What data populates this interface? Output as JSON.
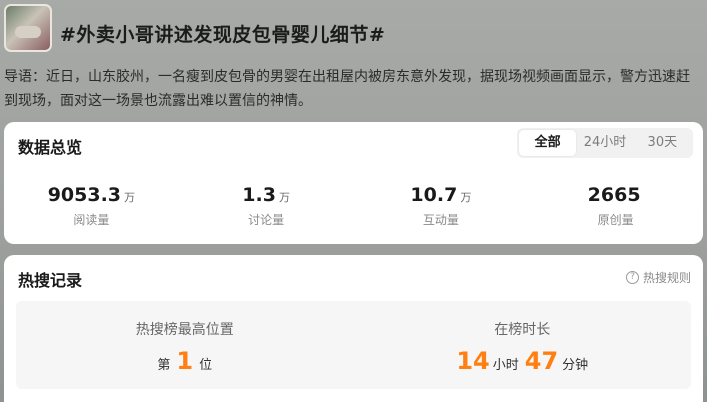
{
  "topic": {
    "title": "#外卖小哥讲述发现皮包骨婴儿细节#",
    "guide": "导语：近日，山东胶州，一名瘦到皮包骨的男婴在出租屋内被房东意外发现，据现场视频画面显示，警方迅速赶到现场，面对这一场景也流露出难以置信的神情。"
  },
  "overview": {
    "title": "数据总览",
    "tabs": [
      "全部",
      "24小时",
      "30天"
    ],
    "active_tab": "全部",
    "stats": [
      {
        "value": "9053.3",
        "unit": "万",
        "label": "阅读量"
      },
      {
        "value": "1.3",
        "unit": "万",
        "label": "讨论量"
      },
      {
        "value": "10.7",
        "unit": "万",
        "label": "互动量"
      },
      {
        "value": "2665",
        "unit": "",
        "label": "原创量"
      }
    ]
  },
  "hot": {
    "title": "热搜记录",
    "rules_label": "热搜规则",
    "rules_icon": "question-circle-icon",
    "peak": {
      "label": "热搜榜最高位置",
      "prefix": "第",
      "value": "1",
      "suffix": "位"
    },
    "duration": {
      "label": "在榜时长",
      "hours": "14",
      "hours_unit": "小时",
      "minutes": "47",
      "minutes_unit": "分钟"
    },
    "accent_color": "#ff7f12"
  }
}
